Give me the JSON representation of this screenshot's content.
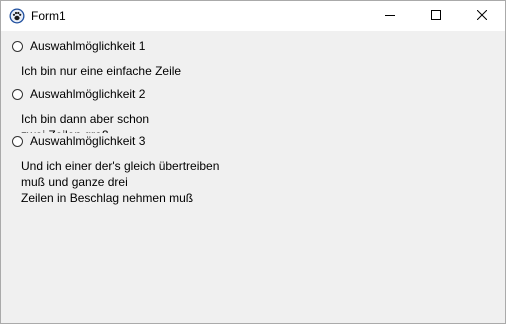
{
  "window": {
    "title": "Form1",
    "app_icon": "paw-icon",
    "controls": {
      "minimize": "minimize-icon",
      "maximize": "maximize-icon",
      "close": "close-icon"
    }
  },
  "options": [
    {
      "label": "Auswahlmöglichkeit 1",
      "description": "Ich bin nur eine einfache Zeile",
      "selected": false
    },
    {
      "label": "Auswahlmöglichkeit 2",
      "description": "Ich bin dann aber schon\nzwei Zeilen groß",
      "selected": false
    },
    {
      "label": "Auswahlmöglichkeit 3",
      "description": "Und ich einer der's gleich übertreiben\nmuß und ganze drei\nZeilen in Beschlag nehmen muß",
      "selected": false
    }
  ]
}
